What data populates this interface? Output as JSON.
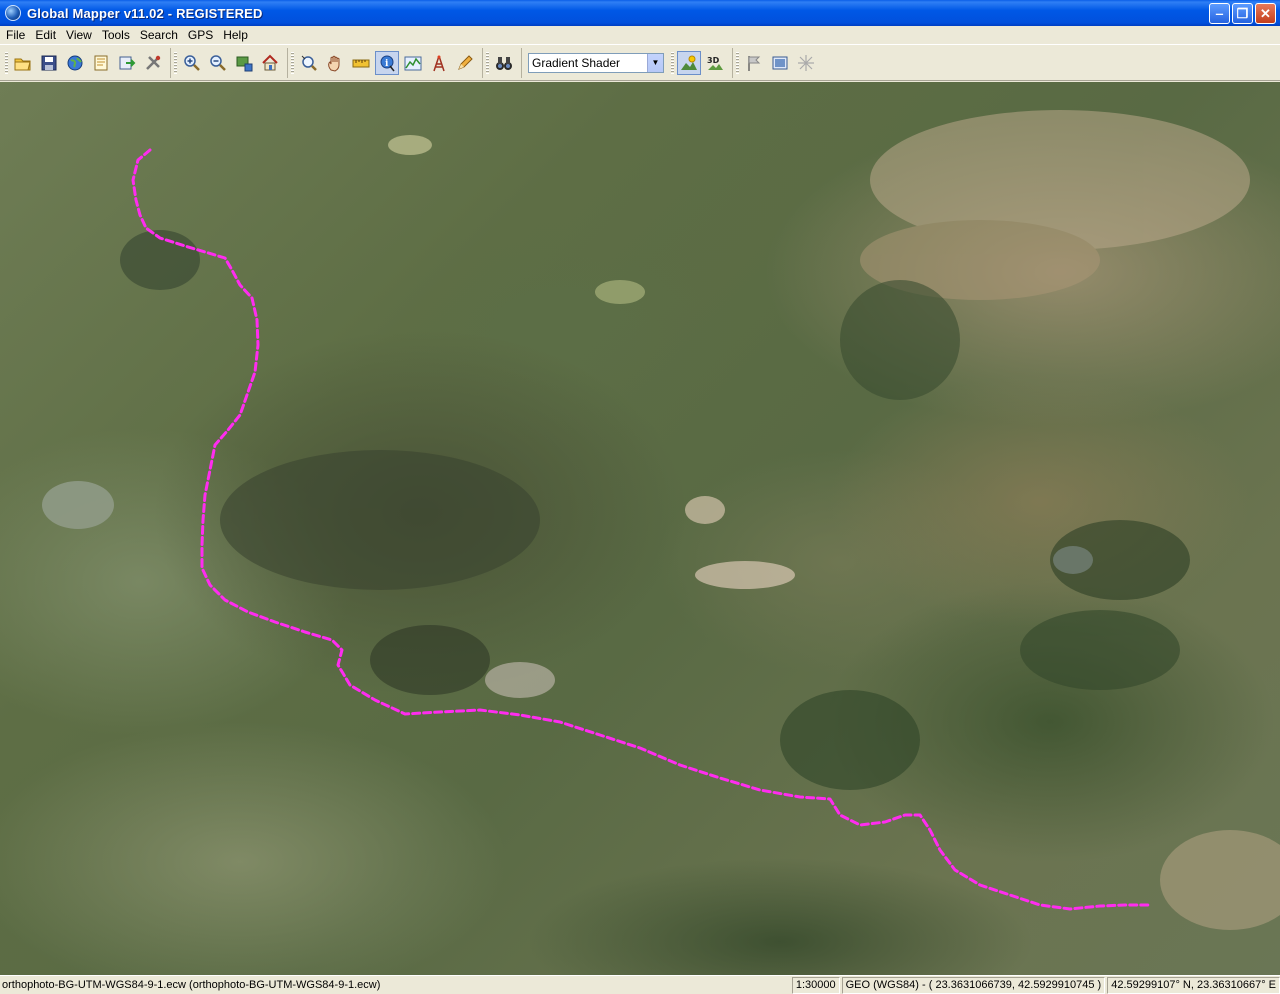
{
  "window": {
    "title": "Global Mapper v11.02 - REGISTERED",
    "controls": [
      "minimize",
      "maximize",
      "close"
    ]
  },
  "menu": [
    "File",
    "Edit",
    "View",
    "Tools",
    "Search",
    "GPS",
    "Help"
  ],
  "toolbar": {
    "groups": [
      [
        "open-folder-icon",
        "save-icon",
        "globe-icon",
        "page-icon",
        "export-icon",
        "tools-icon"
      ],
      [
        "zoom-in-icon",
        "zoom-out-icon",
        "zoom-rect-icon",
        "home-icon"
      ],
      [
        "zoom-tool-icon",
        "pan-hand-icon",
        "measure-icon",
        "info-pointer-icon",
        "path-profile-icon",
        "tower-icon",
        "draw-icon"
      ],
      [
        "binoculars-icon"
      ]
    ],
    "shader_select": "Gradient Shader",
    "after_select": [
      "shader-sun-icon",
      "3d-view-icon"
    ],
    "last_group": [
      "flag-icon",
      "image-window-icon",
      "star-cursor-icon"
    ]
  },
  "map": {
    "layer": "orthophoto",
    "track_color": "#ff2cf0"
  },
  "status": {
    "file": "orthophoto-BG-UTM-WGS84-9-1.ecw (orthophoto-BG-UTM-WGS84-9-1.ecw)",
    "scale": "1:30000",
    "projection": "GEO (WGS84) - ( 23.3631066739, 42.5929910745 )",
    "coords": "42.59299107° N, 23.36310667° E"
  }
}
